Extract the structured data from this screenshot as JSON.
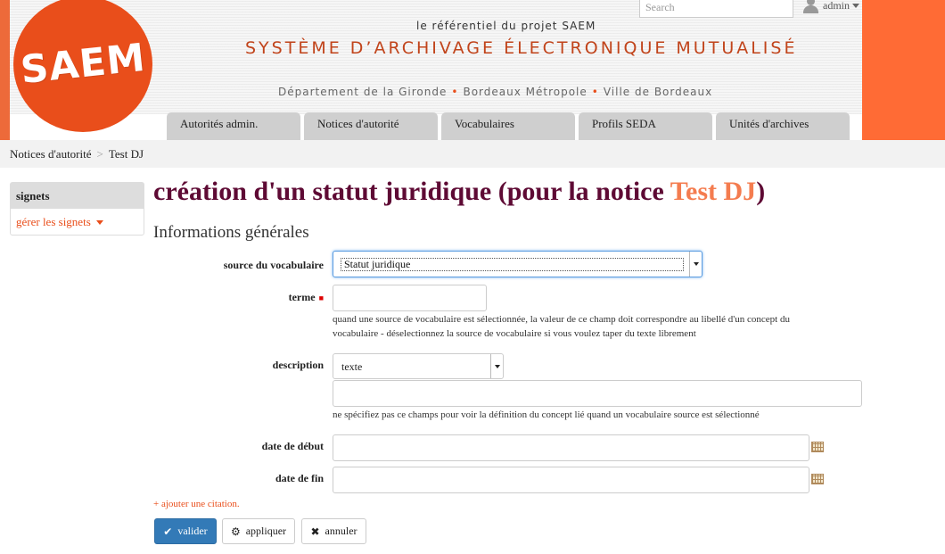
{
  "header": {
    "logo_text": "SAEM",
    "tagline": "le référentiel du projet SAEM",
    "site_title": "SYSTÈME D’ARCHIVAGE ÉLECTRONIQUE MUTUALISÉ",
    "partners": [
      "Département de la Gironde",
      "Bordeaux Métropole",
      "Ville de Bordeaux"
    ],
    "search_placeholder": "Search",
    "user_label": "admin"
  },
  "nav": {
    "tabs": [
      {
        "label": "Autorités admin."
      },
      {
        "label": "Notices d'autorité"
      },
      {
        "label": "Vocabulaires"
      },
      {
        "label": "Profils SEDA"
      },
      {
        "label": "Unités d'archives"
      }
    ]
  },
  "breadcrumb": {
    "items": [
      "Notices d'autorité",
      "Test DJ"
    ],
    "separator": ">"
  },
  "sidebar": {
    "title": "signets",
    "link_label": "gérer les signets"
  },
  "page": {
    "title_prefix": "création d'un statut juridique (pour la notice ",
    "title_highlight": "Test DJ",
    "title_suffix": ")",
    "section_title": "Informations générales"
  },
  "form": {
    "vocab_source": {
      "label": "source du vocabulaire",
      "value": "Statut juridique"
    },
    "terme": {
      "label": "terme",
      "value": "",
      "help": "quand une source de vocabulaire est sélectionnée, la valeur de ce champ doit correspondre au libellé d'un concept du vocabulaire - déselectionnez la source de vocabulaire si vous voulez taper du texte librement"
    },
    "description": {
      "label": "description",
      "format_value": "texte",
      "value": "",
      "help": "ne spécifiez pas ce champs pour voir la définition du concept lié quand un vocabulaire source est sélectionné"
    },
    "date_debut": {
      "label": "date de début",
      "value": ""
    },
    "date_fin": {
      "label": "date de fin",
      "value": ""
    },
    "add_citation": "+ ajouter une citation."
  },
  "buttons": {
    "valider": "valider",
    "appliquer": "appliquer",
    "annuler": "annuler"
  },
  "colors": {
    "brand_orange": "#e94e1b",
    "title_purple": "#5e0a34",
    "primary_button": "#337ab7"
  }
}
